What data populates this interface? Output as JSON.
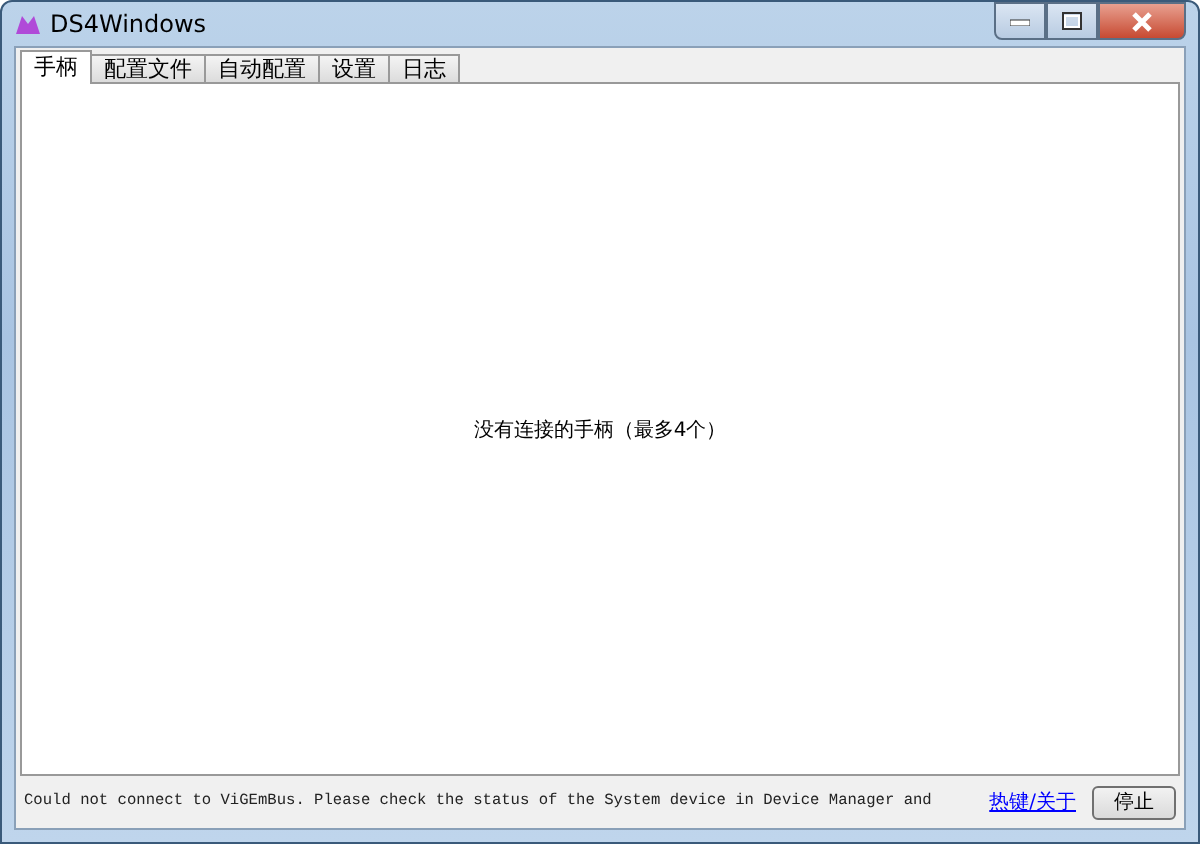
{
  "window": {
    "title": "DS4Windows"
  },
  "tabs": [
    {
      "label": "手柄",
      "selected": true
    },
    {
      "label": "配置文件",
      "selected": false
    },
    {
      "label": "自动配置",
      "selected": false
    },
    {
      "label": "设置",
      "selected": false
    },
    {
      "label": "日志",
      "selected": false
    }
  ],
  "content": {
    "message": "没有连接的手柄（最多4个）"
  },
  "status_bar": {
    "message": "Could not connect to ViGEmBus. Please check the status of the System device in Device Manager and",
    "link": "热键/关于",
    "button": "停止"
  }
}
